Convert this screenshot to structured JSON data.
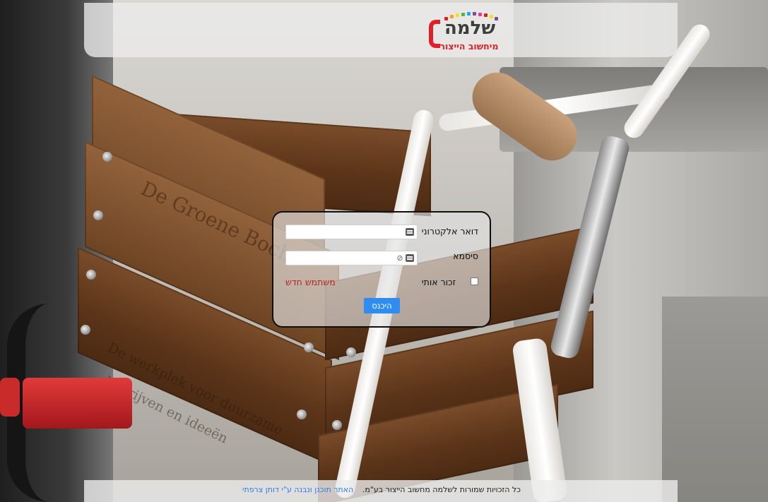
{
  "header": {
    "logo_name": "שלמה",
    "logo_tagline": "מיחשוב הייצור",
    "logo_colors": [
      "#e11f26",
      "#f7a21b",
      "#f2e01d",
      "#4cb748",
      "#27a9e1",
      "#7e4aa0",
      "#e83e8c"
    ]
  },
  "login": {
    "email_label": "דואר אלקטרוני",
    "email_value": "",
    "password_label": "סיסמא",
    "password_value": "",
    "remember_label": "זכור אותי",
    "remember_checked": false,
    "new_user_label": "משתמש חדש",
    "submit_label": "היכנס"
  },
  "footer": {
    "copyright": "כל הזכויות שמורות לשלמה מחשוב הייצור בע\"מ.",
    "credit_link": "האתר תוכנן ונבנה ע\"י דותן צרפתי"
  },
  "colors": {
    "accent": "#2f8cf0",
    "link_red": "#b3261e",
    "link_blue": "#2f7ee8"
  }
}
